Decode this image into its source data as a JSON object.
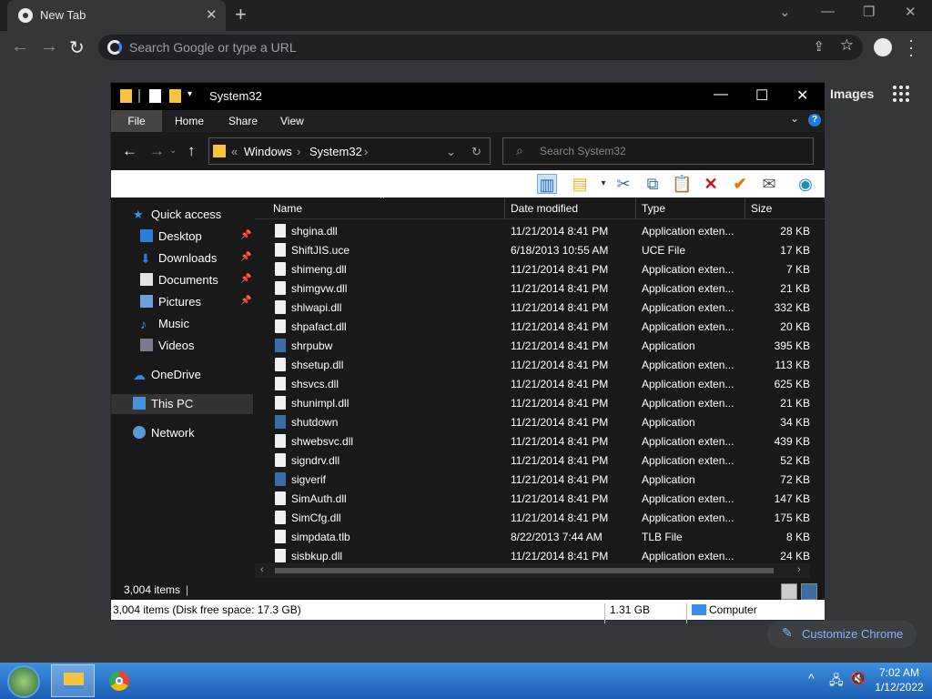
{
  "browser": {
    "tab_title": "New Tab",
    "omnibox_placeholder": "Search Google or type a URL",
    "images_link": "Images",
    "customize_label": "Customize Chrome"
  },
  "explorer": {
    "title": "System32",
    "ribbon_tabs": [
      "File",
      "Home",
      "Share",
      "View"
    ],
    "breadcrumb": [
      "Windows",
      "System32"
    ],
    "breadcrumb_prefix": "«",
    "search_placeholder": "Search System32",
    "sidebar": [
      {
        "label": "Quick access",
        "icon": "star-icon"
      },
      {
        "label": "Desktop",
        "icon": "desktop-icon",
        "pinned": true
      },
      {
        "label": "Downloads",
        "icon": "downloads-icon",
        "pinned": true
      },
      {
        "label": "Documents",
        "icon": "documents-icon",
        "pinned": true
      },
      {
        "label": "Pictures",
        "icon": "pictures-icon",
        "pinned": true
      },
      {
        "label": "Music",
        "icon": "music-icon"
      },
      {
        "label": "Videos",
        "icon": "videos-icon"
      },
      {
        "label": "OneDrive",
        "icon": "onedrive-icon"
      },
      {
        "label": "This PC",
        "icon": "pc-icon",
        "selected": true
      },
      {
        "label": "Network",
        "icon": "network-icon"
      }
    ],
    "columns": [
      "Name",
      "Date modified",
      "Type",
      "Size"
    ],
    "files": [
      {
        "name": "shgina.dll",
        "date": "11/21/2014 8:41 PM",
        "type": "Application exten...",
        "size": "28 KB"
      },
      {
        "name": "ShiftJIS.uce",
        "date": "6/18/2013 10:55 AM",
        "type": "UCE File",
        "size": "17 KB"
      },
      {
        "name": "shimeng.dll",
        "date": "11/21/2014 8:41 PM",
        "type": "Application exten...",
        "size": "7 KB"
      },
      {
        "name": "shimgvw.dll",
        "date": "11/21/2014 8:41 PM",
        "type": "Application exten...",
        "size": "21 KB"
      },
      {
        "name": "shlwapi.dll",
        "date": "11/21/2014 8:41 PM",
        "type": "Application exten...",
        "size": "332 KB"
      },
      {
        "name": "shpafact.dll",
        "date": "11/21/2014 8:41 PM",
        "type": "Application exten...",
        "size": "20 KB"
      },
      {
        "name": "shrpubw",
        "date": "11/21/2014 8:41 PM",
        "type": "Application",
        "size": "395 KB"
      },
      {
        "name": "shsetup.dll",
        "date": "11/21/2014 8:41 PM",
        "type": "Application exten...",
        "size": "113 KB"
      },
      {
        "name": "shsvcs.dll",
        "date": "11/21/2014 8:41 PM",
        "type": "Application exten...",
        "size": "625 KB"
      },
      {
        "name": "shunimpl.dll",
        "date": "11/21/2014 8:41 PM",
        "type": "Application exten...",
        "size": "21 KB"
      },
      {
        "name": "shutdown",
        "date": "11/21/2014 8:41 PM",
        "type": "Application",
        "size": "34 KB"
      },
      {
        "name": "shwebsvc.dll",
        "date": "11/21/2014 8:41 PM",
        "type": "Application exten...",
        "size": "439 KB"
      },
      {
        "name": "signdrv.dll",
        "date": "11/21/2014 8:41 PM",
        "type": "Application exten...",
        "size": "52 KB"
      },
      {
        "name": "sigverif",
        "date": "11/21/2014 8:41 PM",
        "type": "Application",
        "size": "72 KB"
      },
      {
        "name": "SimAuth.dll",
        "date": "11/21/2014 8:41 PM",
        "type": "Application exten...",
        "size": "147 KB"
      },
      {
        "name": "SimCfg.dll",
        "date": "11/21/2014 8:41 PM",
        "type": "Application exten...",
        "size": "175 KB"
      },
      {
        "name": "simpdata.tlb",
        "date": "8/22/2013 7:44 AM",
        "type": "TLB File",
        "size": "8 KB"
      },
      {
        "name": "sisbkup.dll",
        "date": "11/21/2014 8:41 PM",
        "type": "Application exten...",
        "size": "24 KB"
      }
    ],
    "status_items": "3,004 items",
    "bottom_status": "3,004 items (Disk free space: 17.3 GB)",
    "bottom_size": "1.31 GB",
    "bottom_location": "Computer"
  },
  "taskbar": {
    "time": "7:02 AM",
    "date": "1/12/2022"
  }
}
